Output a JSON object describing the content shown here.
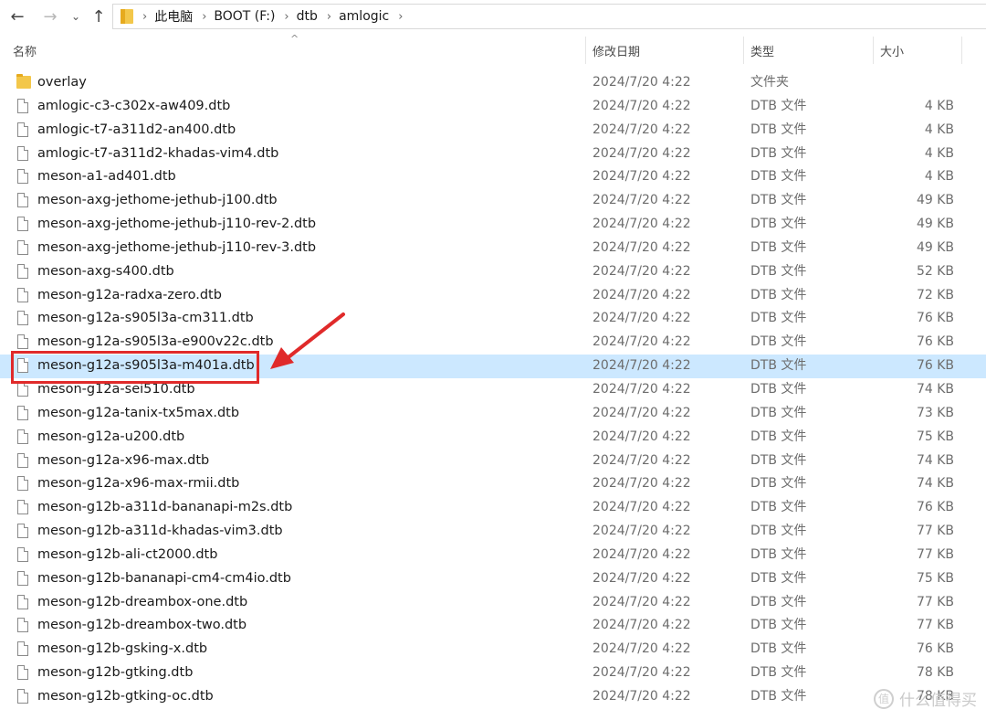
{
  "nav": {
    "back_icon": "←",
    "forward_icon": "→",
    "dropdown_icon": "⌄",
    "up_icon": "↑"
  },
  "breadcrumb": [
    "此电脑",
    "BOOT (F:)",
    "dtb",
    "amlogic"
  ],
  "columns": {
    "name": "名称",
    "date": "修改日期",
    "type": "类型",
    "size": "大小"
  },
  "files": [
    {
      "name": "overlay",
      "date": "2024/7/20 4:22",
      "type": "文件夹",
      "size": "",
      "kind": "folder"
    },
    {
      "name": "amlogic-c3-c302x-aw409.dtb",
      "date": "2024/7/20 4:22",
      "type": "DTB 文件",
      "size": "4 KB",
      "kind": "file"
    },
    {
      "name": "amlogic-t7-a311d2-an400.dtb",
      "date": "2024/7/20 4:22",
      "type": "DTB 文件",
      "size": "4 KB",
      "kind": "file"
    },
    {
      "name": "amlogic-t7-a311d2-khadas-vim4.dtb",
      "date": "2024/7/20 4:22",
      "type": "DTB 文件",
      "size": "4 KB",
      "kind": "file"
    },
    {
      "name": "meson-a1-ad401.dtb",
      "date": "2024/7/20 4:22",
      "type": "DTB 文件",
      "size": "4 KB",
      "kind": "file"
    },
    {
      "name": "meson-axg-jethome-jethub-j100.dtb",
      "date": "2024/7/20 4:22",
      "type": "DTB 文件",
      "size": "49 KB",
      "kind": "file"
    },
    {
      "name": "meson-axg-jethome-jethub-j110-rev-2.dtb",
      "date": "2024/7/20 4:22",
      "type": "DTB 文件",
      "size": "49 KB",
      "kind": "file"
    },
    {
      "name": "meson-axg-jethome-jethub-j110-rev-3.dtb",
      "date": "2024/7/20 4:22",
      "type": "DTB 文件",
      "size": "49 KB",
      "kind": "file"
    },
    {
      "name": "meson-axg-s400.dtb",
      "date": "2024/7/20 4:22",
      "type": "DTB 文件",
      "size": "52 KB",
      "kind": "file"
    },
    {
      "name": "meson-g12a-radxa-zero.dtb",
      "date": "2024/7/20 4:22",
      "type": "DTB 文件",
      "size": "72 KB",
      "kind": "file"
    },
    {
      "name": "meson-g12a-s905l3a-cm311.dtb",
      "date": "2024/7/20 4:22",
      "type": "DTB 文件",
      "size": "76 KB",
      "kind": "file"
    },
    {
      "name": "meson-g12a-s905l3a-e900v22c.dtb",
      "date": "2024/7/20 4:22",
      "type": "DTB 文件",
      "size": "76 KB",
      "kind": "file"
    },
    {
      "name": "meson-g12a-s905l3a-m401a.dtb",
      "date": "2024/7/20 4:22",
      "type": "DTB 文件",
      "size": "76 KB",
      "kind": "file",
      "selected": true
    },
    {
      "name": "meson-g12a-sei510.dtb",
      "date": "2024/7/20 4:22",
      "type": "DTB 文件",
      "size": "74 KB",
      "kind": "file"
    },
    {
      "name": "meson-g12a-tanix-tx5max.dtb",
      "date": "2024/7/20 4:22",
      "type": "DTB 文件",
      "size": "73 KB",
      "kind": "file"
    },
    {
      "name": "meson-g12a-u200.dtb",
      "date": "2024/7/20 4:22",
      "type": "DTB 文件",
      "size": "75 KB",
      "kind": "file"
    },
    {
      "name": "meson-g12a-x96-max.dtb",
      "date": "2024/7/20 4:22",
      "type": "DTB 文件",
      "size": "74 KB",
      "kind": "file"
    },
    {
      "name": "meson-g12a-x96-max-rmii.dtb",
      "date": "2024/7/20 4:22",
      "type": "DTB 文件",
      "size": "74 KB",
      "kind": "file"
    },
    {
      "name": "meson-g12b-a311d-bananapi-m2s.dtb",
      "date": "2024/7/20 4:22",
      "type": "DTB 文件",
      "size": "76 KB",
      "kind": "file"
    },
    {
      "name": "meson-g12b-a311d-khadas-vim3.dtb",
      "date": "2024/7/20 4:22",
      "type": "DTB 文件",
      "size": "77 KB",
      "kind": "file"
    },
    {
      "name": "meson-g12b-ali-ct2000.dtb",
      "date": "2024/7/20 4:22",
      "type": "DTB 文件",
      "size": "77 KB",
      "kind": "file"
    },
    {
      "name": "meson-g12b-bananapi-cm4-cm4io.dtb",
      "date": "2024/7/20 4:22",
      "type": "DTB 文件",
      "size": "75 KB",
      "kind": "file"
    },
    {
      "name": "meson-g12b-dreambox-one.dtb",
      "date": "2024/7/20 4:22",
      "type": "DTB 文件",
      "size": "77 KB",
      "kind": "file"
    },
    {
      "name": "meson-g12b-dreambox-two.dtb",
      "date": "2024/7/20 4:22",
      "type": "DTB 文件",
      "size": "77 KB",
      "kind": "file"
    },
    {
      "name": "meson-g12b-gsking-x.dtb",
      "date": "2024/7/20 4:22",
      "type": "DTB 文件",
      "size": "76 KB",
      "kind": "file"
    },
    {
      "name": "meson-g12b-gtking.dtb",
      "date": "2024/7/20 4:22",
      "type": "DTB 文件",
      "size": "78 KB",
      "kind": "file"
    },
    {
      "name": "meson-g12b-gtking-oc.dtb",
      "date": "2024/7/20 4:22",
      "type": "DTB 文件",
      "size": "78 KB",
      "kind": "file"
    }
  ],
  "watermark": {
    "text": "什么值得买",
    "logo": "值"
  },
  "colors": {
    "selected_row": "#cce8ff",
    "annotation": "#e02a2a",
    "folder": "#f3c74a"
  }
}
